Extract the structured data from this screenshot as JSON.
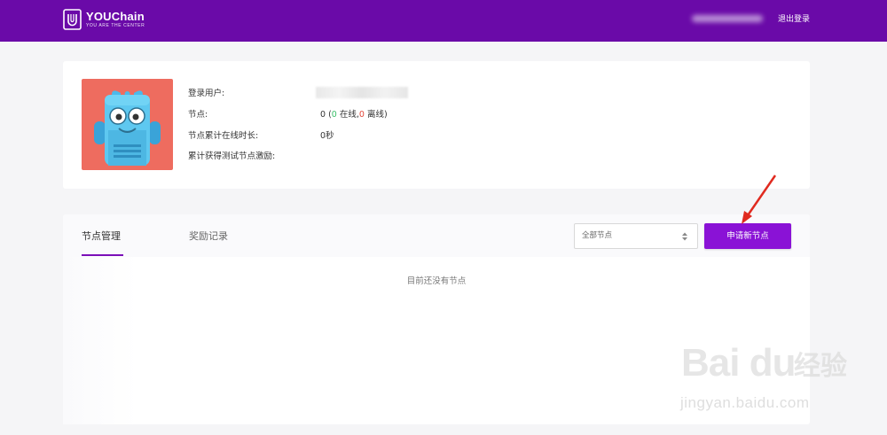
{
  "header": {
    "brand_name": "YOUChain",
    "brand_tagline": "YOU ARE THE CENTER",
    "logout_label": "退出登录",
    "background_color": "#6a0aa8"
  },
  "profile": {
    "labels": {
      "user": "登录用户:",
      "nodes": "节点:",
      "online_time": "节点累计在线时长:",
      "rewards": "累计获得测试节点激励:"
    },
    "nodes": {
      "total": "0",
      "open_paren": " (",
      "online_count": "0",
      "online_label": " 在线,",
      "offline_count": "0",
      "offline_label": " 离线)"
    },
    "online_time_value": "0秒"
  },
  "nodes_section": {
    "tabs": [
      {
        "label": "节点管理",
        "active": true
      },
      {
        "label": "奖励记录",
        "active": false
      }
    ],
    "filter": {
      "selected": "全部节点"
    },
    "apply_button_label": "申请新节点",
    "empty_message": "目前还没有节点",
    "accent_color": "#8a12d6"
  },
  "watermark": {
    "brand": "Bai du",
    "cn": "经验",
    "url": "jingyan.baidu.com"
  }
}
